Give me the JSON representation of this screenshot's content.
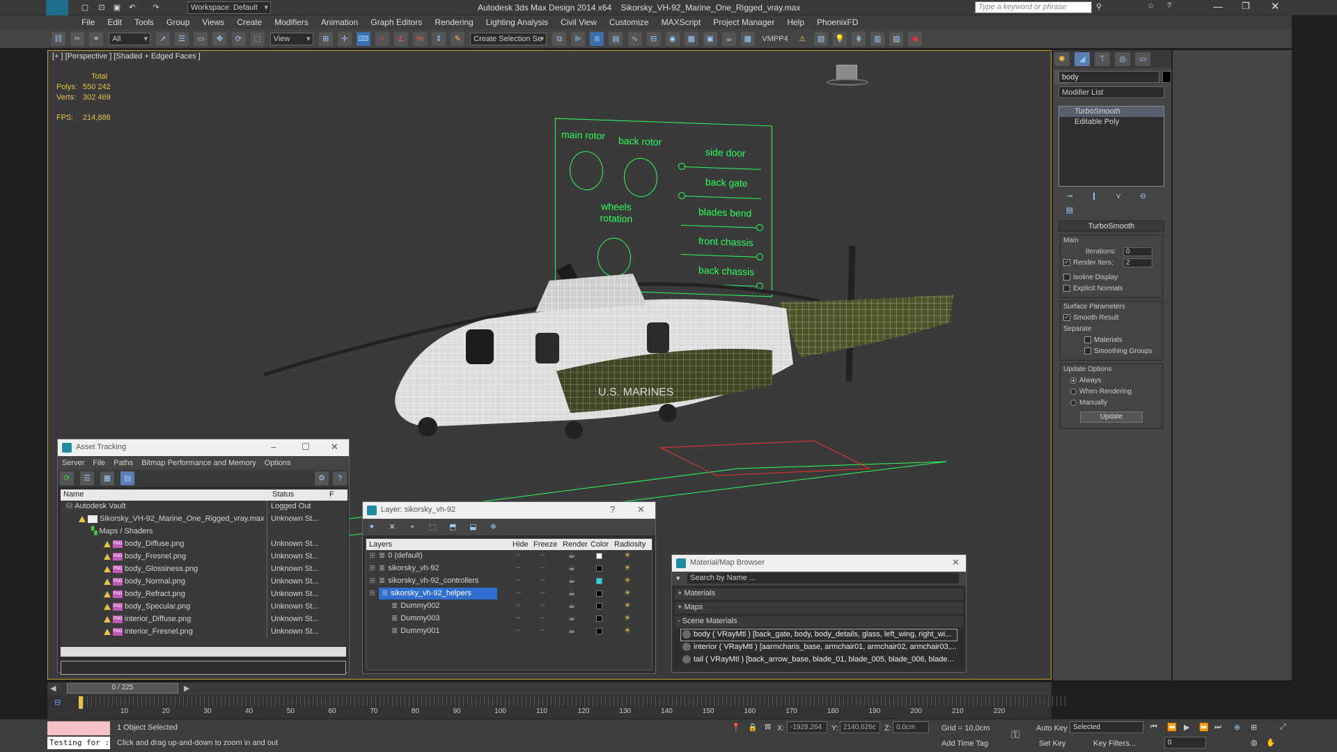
{
  "app": {
    "title": "Autodesk 3ds Max Design 2014 x64    Sikorsky_VH-92_Marine_One_Rigged_vray.max",
    "workspace": "Workspace: Default",
    "search_placeholder": "Type a keyword or phrase",
    "logo": "MAX"
  },
  "menu": [
    "File",
    "Edit",
    "Tools",
    "Group",
    "Views",
    "Create",
    "Modifiers",
    "Animation",
    "Graph Editors",
    "Rendering",
    "Lighting Analysis",
    "Civil View",
    "Customize",
    "MAXScript",
    "Project Manager",
    "Help",
    "PhoenixFD"
  ],
  "toolbar": {
    "filter": "All",
    "ref_coord": "View",
    "selection_set": "Create Selection Se",
    "vmpp": "VMPP4"
  },
  "viewport": {
    "label": "[+ ] [Perspective ] [Shaded + Edged Faces ]",
    "stats": {
      "total_label": "Total",
      "polys_label": "Polys:",
      "polys": "550 242",
      "verts_label": "Verts:",
      "verts": "302 469",
      "fps_label": "FPS:",
      "fps": "214,888"
    },
    "control_panel": {
      "main_rotor": "main rotor",
      "back_rotor": "back rotor",
      "wheels_rotation": "wheels rotation",
      "side_door": "side door",
      "back_gate": "back gate",
      "blades_bend": "blades bend",
      "front_chassis": "front chassis",
      "back_chassis": "back chassis"
    },
    "heli_text": "U.S. MARINES"
  },
  "command_panel": {
    "object_name": "body",
    "modifier_list": "Modifier List",
    "stack": [
      "TurboSmooth",
      "Editable Poly"
    ],
    "turbosmooth": {
      "title": "TurboSmooth",
      "main": "Main",
      "iterations_label": "Iterations:",
      "iterations": "0",
      "render_iters_label": "Render Iters:",
      "render_iters": "2",
      "isoline": "Isoline Display",
      "explicit": "Explicit Normals",
      "surface": "Surface Parameters",
      "smooth": "Smooth Result",
      "separate": "Separate",
      "materials": "Materials",
      "smoothing_groups": "Smoothing Groups",
      "update_options": "Update Options",
      "always": "Always",
      "when_rendering": "When Rendering",
      "manually": "Manually",
      "update_btn": "Update"
    }
  },
  "asset_tracking": {
    "title": "Asset Tracking",
    "menu": [
      "Server",
      "File",
      "Paths",
      "Bitmap Performance and Memory",
      "Options"
    ],
    "col_name": "Name",
    "col_status": "Status",
    "col_extra": "F",
    "rows": [
      {
        "name": "Autodesk Vault",
        "status": "Logged Out",
        "indent": 0,
        "icon": "vault"
      },
      {
        "name": "Sikorsky_VH-92_Marine_One_Rigged_vray.max",
        "status": "Unknown St...",
        "indent": 1,
        "icon": "max"
      },
      {
        "name": "Maps / Shaders",
        "status": "",
        "indent": 2,
        "icon": "maps"
      },
      {
        "name": "body_Diffuse.png",
        "status": "Unknown St...",
        "indent": 3,
        "icon": "png"
      },
      {
        "name": "body_Fresnel.png",
        "status": "Unknown St...",
        "indent": 3,
        "icon": "png"
      },
      {
        "name": "body_Glossiness.png",
        "status": "Unknown St...",
        "indent": 3,
        "icon": "png"
      },
      {
        "name": "body_Normal.png",
        "status": "Unknown St...",
        "indent": 3,
        "icon": "png"
      },
      {
        "name": "body_Refract.png",
        "status": "Unknown St...",
        "indent": 3,
        "icon": "png"
      },
      {
        "name": "body_Specular.png",
        "status": "Unknown St...",
        "indent": 3,
        "icon": "png"
      },
      {
        "name": "interior_Diffuse.png",
        "status": "Unknown St...",
        "indent": 3,
        "icon": "png"
      },
      {
        "name": "interior_Fresnel.png",
        "status": "Unknown St...",
        "indent": 3,
        "icon": "png"
      }
    ]
  },
  "layer_manager": {
    "title": "Layer: sikorsky_vh-92",
    "help": "?",
    "cols": {
      "layers": "Layers",
      "hide": "Hide",
      "freeze": "Freeze",
      "render": "Render",
      "color": "Color",
      "radiosity": "Radiosity"
    },
    "rows": [
      {
        "name": "0 (default)",
        "indent": 0,
        "color": "#ffffff",
        "selected": false
      },
      {
        "name": "sikorsky_vh-92",
        "indent": 0,
        "color": "#000000",
        "selected": false
      },
      {
        "name": "sikorsky_vh-92_controllers",
        "indent": 0,
        "color": "#20d8e0",
        "selected": false
      },
      {
        "name": "sikorsky_vh-92_helpers",
        "indent": 0,
        "color": "#000000",
        "selected": true
      },
      {
        "name": "Dummy002",
        "indent": 1,
        "color": "#000000",
        "selected": false
      },
      {
        "name": "Dummy003",
        "indent": 1,
        "color": "#000000",
        "selected": false
      },
      {
        "name": "Dummy001",
        "indent": 1,
        "color": "#000000",
        "selected": false
      }
    ]
  },
  "material_browser": {
    "title": "Material/Map Browser",
    "search": "Search by Name ...",
    "materials": "+ Materials",
    "maps": "+ Maps",
    "scene_materials": "- Scene Materials",
    "items": [
      "body ( VRayMtl ) [back_gate, body, body_details, glass, left_wing, right_wi...",
      "interior ( VRayMtl ) [aarmcharis_base, armchair01, armchair02, armchair03,...",
      "tail ( VRayMtl ) [back_arrow_base, blade_01, blade_005, blade_006, blade..."
    ]
  },
  "time": {
    "frame": "0 / 225",
    "ticks": [
      "10",
      "20",
      "30",
      "40",
      "50",
      "60",
      "70",
      "80",
      "90",
      "100",
      "110",
      "120",
      "130",
      "140",
      "150",
      "160",
      "170",
      "180",
      "190",
      "200",
      "210",
      "220"
    ]
  },
  "status": {
    "script": "Testing for :",
    "selected": "1 Object Selected",
    "prompt": "Click and drag up-and-down to zoom in and out",
    "x_label": "X:",
    "x": "-1928,264",
    "y_label": "Y:",
    "y": "2140,626c",
    "z_label": "Z:",
    "z": "0,0cm",
    "grid": "Grid = 10,0cm",
    "auto_key": "Auto Key",
    "selected_combo": "Selected",
    "set_key": "Set Key",
    "key_filters": "Key Filters...",
    "add_time_tag": "Add Time Tag",
    "frame_spinner": "0"
  }
}
